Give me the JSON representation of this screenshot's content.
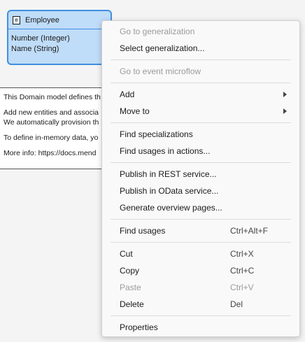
{
  "entity": {
    "icon_glyph": "e",
    "icon": "entity-icon",
    "title": "Employee",
    "attributes": [
      "Number (Integer)",
      "Name (String)"
    ]
  },
  "note": {
    "lines": [
      "This Domain model defines th",
      "Add new entities and associa",
      "We automatically provision th",
      "To define in-memory data, yo",
      "More info: https://docs.mend"
    ]
  },
  "menu": {
    "groups": [
      [
        {
          "label": "Go to generalization",
          "disabled": true
        },
        {
          "label": "Select generalization...",
          "disabled": false
        }
      ],
      [
        {
          "label": "Go to event microflow",
          "disabled": true
        }
      ],
      [
        {
          "label": "Add",
          "disabled": false,
          "submenu": true
        },
        {
          "label": "Move to",
          "disabled": false,
          "submenu": true
        }
      ],
      [
        {
          "label": "Find specializations",
          "disabled": false
        },
        {
          "label": "Find usages in actions...",
          "disabled": false
        }
      ],
      [
        {
          "label": "Publish in REST service...",
          "disabled": false
        },
        {
          "label": "Publish in OData service...",
          "disabled": false
        },
        {
          "label": "Generate overview pages...",
          "disabled": false
        }
      ],
      [
        {
          "label": "Find usages",
          "shortcut": "Ctrl+Alt+F",
          "disabled": false
        }
      ],
      [
        {
          "label": "Cut",
          "shortcut": "Ctrl+X",
          "disabled": false
        },
        {
          "label": "Copy",
          "shortcut": "Ctrl+C",
          "disabled": false
        },
        {
          "label": "Paste",
          "shortcut": "Ctrl+V",
          "disabled": true
        },
        {
          "label": "Delete",
          "shortcut": "Del",
          "disabled": false
        }
      ],
      [
        {
          "label": "Properties",
          "disabled": false
        }
      ]
    ]
  }
}
